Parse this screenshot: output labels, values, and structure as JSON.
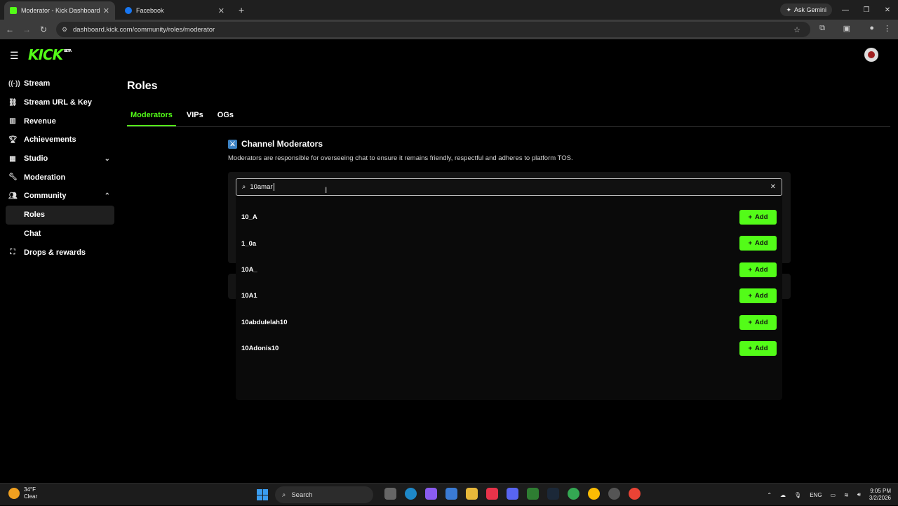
{
  "browser": {
    "tabs": [
      {
        "title": "Moderator - Kick Dashboard",
        "active": true
      },
      {
        "title": "Facebook",
        "active": false
      }
    ],
    "ask_gemini": "Ask Gemini",
    "url": "dashboard.kick.com/community/roles/moderator"
  },
  "header": {
    "logo": "KICK",
    "logo_badge": "BETA"
  },
  "sidebar": {
    "items": [
      {
        "label": "Stream",
        "icon": "broadcast-icon"
      },
      {
        "label": "Stream URL & Key",
        "icon": "link-icon"
      },
      {
        "label": "Revenue",
        "icon": "chart-icon"
      },
      {
        "label": "Achievements",
        "icon": "trophy-icon"
      },
      {
        "label": "Studio",
        "icon": "studio-icon"
      },
      {
        "label": "Moderation",
        "icon": "wrench-icon"
      },
      {
        "label": "Community",
        "icon": "users-icon"
      },
      {
        "label": "Roles"
      },
      {
        "label": "Chat"
      },
      {
        "label": "Drops & rewards",
        "icon": "gift-icon"
      }
    ]
  },
  "main": {
    "title": "Roles",
    "tabs": [
      {
        "label": "Moderators",
        "active": true
      },
      {
        "label": "VIPs",
        "active": false
      },
      {
        "label": "OGs",
        "active": false
      }
    ],
    "section_title": "Channel Moderators",
    "section_desc": "Moderators are responsible for overseeing chat to ensure it remains friendly, respectful and adheres to platform TOS.",
    "search_value": "10amar",
    "add_label": "Add",
    "results": [
      "10_A",
      "1_0a",
      "10A_",
      "10A1",
      "10abdulelah10",
      "10Adonis10"
    ]
  },
  "taskbar": {
    "temp": "34°F",
    "weather": "Clear",
    "search": "Search",
    "lang": "ENG",
    "time": "9:05 PM",
    "date": "3/2/2026"
  },
  "colors": {
    "accent": "#53fc18",
    "background": "#000000"
  }
}
